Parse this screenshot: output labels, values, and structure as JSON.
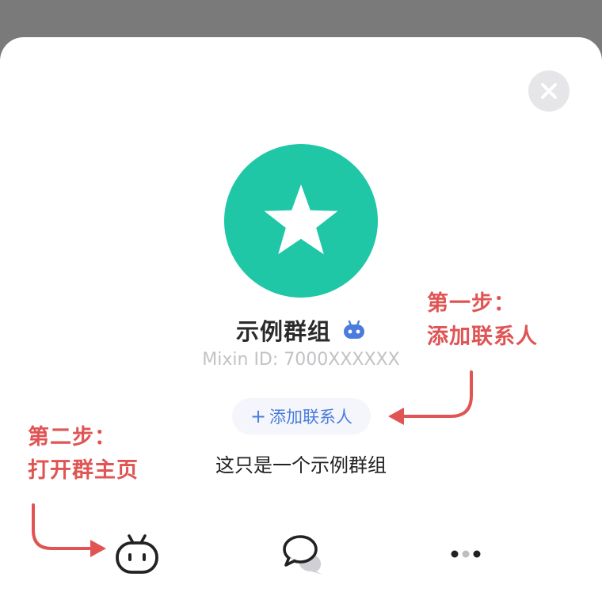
{
  "group": {
    "name": "示例群组",
    "mixin_id": "Mixin ID: 7000XXXXXX",
    "description": "这只是一个示例群组"
  },
  "actions": {
    "add_contact_plus": "+",
    "add_contact_label": "添加联系人"
  },
  "annotations": {
    "step1_title": "第一步：",
    "step1_body": "添加联系人",
    "step2_title": "第二步：",
    "step2_body": "打开群主页"
  },
  "icons": {
    "close": "close-icon",
    "avatar": "star-icon",
    "badge": "bot-icon",
    "home": "bot-home-icon",
    "chat": "chat-bubbles-icon",
    "more": "more-dots-icon"
  },
  "colors": {
    "avatar_bg": "#1fc7a7",
    "accent_blue": "#4b7cdd",
    "annotation_red": "#e05454",
    "backdrop": "#7a7a7a"
  }
}
